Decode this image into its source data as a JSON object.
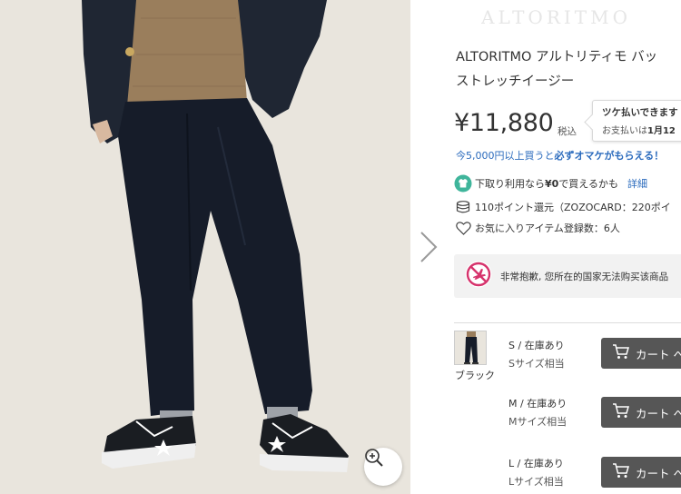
{
  "product": {
    "title_line1": "ALTORITMO アルトリティモ バッ",
    "title_line2": "ストレッチイージー",
    "price": "¥11,880",
    "tax_label": "税込",
    "paylater": {
      "line1": "ツケ払いできます",
      "line2_prefix": "お支払いは",
      "line2_date": "1月12"
    },
    "promo_prefix": "今5,000円以上買うと",
    "promo_bold": "必ずオマケがもらえる！",
    "tradein_prefix": "下取り利用なら",
    "tradein_bold": "¥0",
    "tradein_suffix": "で買えるかも",
    "tradein_link": "詳細",
    "points": "110ポイント還元（ZOZOCARD：220ポイ",
    "favorites": "お気に入りアイテム登録数：6人",
    "notice": "非常抱歉, 您所在的国家无法购买该商品"
  },
  "variants": {
    "color_label": "ブラック",
    "sizes": [
      {
        "stock": "S / 在庫あり",
        "fit": "Sサイズ相当",
        "cart_label": "カート へ"
      },
      {
        "stock": "M / 在庫あり",
        "fit": "Mサイズ相当",
        "cart_label": "カート へ"
      },
      {
        "stock": "L / 在庫あり",
        "fit": "Lサイズ相当",
        "cart_label": "カート へ"
      }
    ]
  },
  "colors": {
    "link_blue": "#2b6bbd",
    "tradein_green": "#3fb59b",
    "no_entry_red": "#d6336c",
    "cart_gray": "#565656"
  },
  "icons": [
    "zoom-in-icon",
    "chevron-right-icon",
    "tshirt-recycle-icon",
    "coin-stack-icon",
    "heart-outline-icon",
    "no-entry-plane-icon",
    "cart-icon"
  ]
}
